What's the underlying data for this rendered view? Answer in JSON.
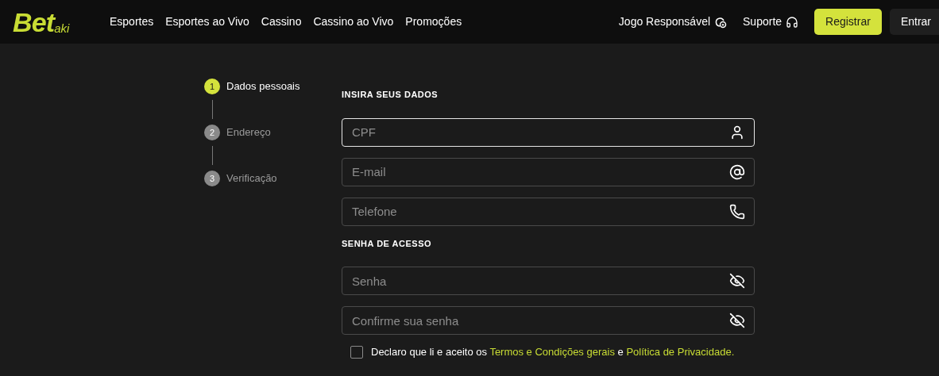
{
  "header": {
    "logo": {
      "main": "Bet",
      "sub": "aki"
    },
    "nav": [
      "Esportes",
      "Esportes ao Vivo",
      "Cassino",
      "Cassino ao Vivo",
      "Promoções"
    ],
    "links": [
      {
        "label": "Jogo Responsável",
        "kind": "responsible"
      },
      {
        "label": "Suporte",
        "kind": "support"
      }
    ],
    "register_button": "Registrar",
    "login_button": "Entrar"
  },
  "steps": [
    {
      "number": "1",
      "label": "Dados pessoais",
      "selected": true
    },
    {
      "number": "2",
      "label": "Endereço",
      "selected": false
    },
    {
      "number": "3",
      "label": "Verificação",
      "selected": false
    }
  ],
  "sections": [
    {
      "title": "INSIRA SEUS DADOS",
      "fields": [
        {
          "placeholder": "CPF",
          "kind": "user",
          "focused": true
        },
        {
          "placeholder": "E-mail",
          "kind": "email",
          "focused": false
        },
        {
          "placeholder": "Telefone",
          "kind": "phone",
          "focused": false
        }
      ]
    },
    {
      "title": "SENHA DE ACESSO",
      "fields": [
        {
          "placeholder": "Senha",
          "kind": "password",
          "focused": false
        },
        {
          "placeholder": "Confirme sua senha",
          "kind": "password",
          "focused": false
        }
      ]
    }
  ],
  "consent": {
    "checked": false,
    "text_before": "Declaro que li e aceito os",
    "link_terms": "Termos e Condições gerais",
    "text_between": "e",
    "link_privacy": "Política de Privacidade."
  }
}
